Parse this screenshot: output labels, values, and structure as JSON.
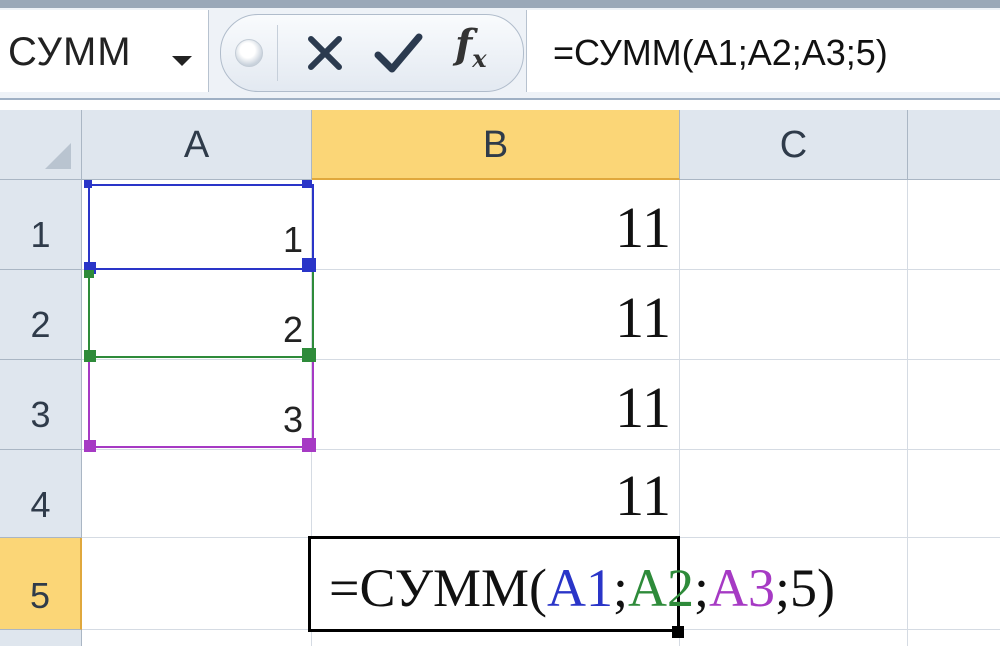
{
  "formula_bar": {
    "name_box": "СУММ",
    "cancel_icon": "close-icon",
    "enter_icon": "checkmark-icon",
    "fx_label": "f",
    "fx_sub": "x",
    "formula": "=СУММ(A1;A2;A3;5)"
  },
  "columns": [
    "A",
    "B",
    "C"
  ],
  "rows": [
    "1",
    "2",
    "3",
    "4",
    "5"
  ],
  "cells": {
    "A1": "1",
    "A2": "2",
    "A3": "3",
    "B1": "11",
    "B2": "11",
    "B3": "11",
    "B4": "11"
  },
  "editing_cell": {
    "prefix": "=СУММ(",
    "ref1": "A1",
    "sep1": ";",
    "ref2": "A2",
    "sep2": ";",
    "ref3": "A3",
    "suffix": ";5)"
  },
  "colors": {
    "ref1": "#2a35c8",
    "ref2": "#2e8b3a",
    "ref3": "#a63ac4",
    "active_header": "#fbd677"
  }
}
